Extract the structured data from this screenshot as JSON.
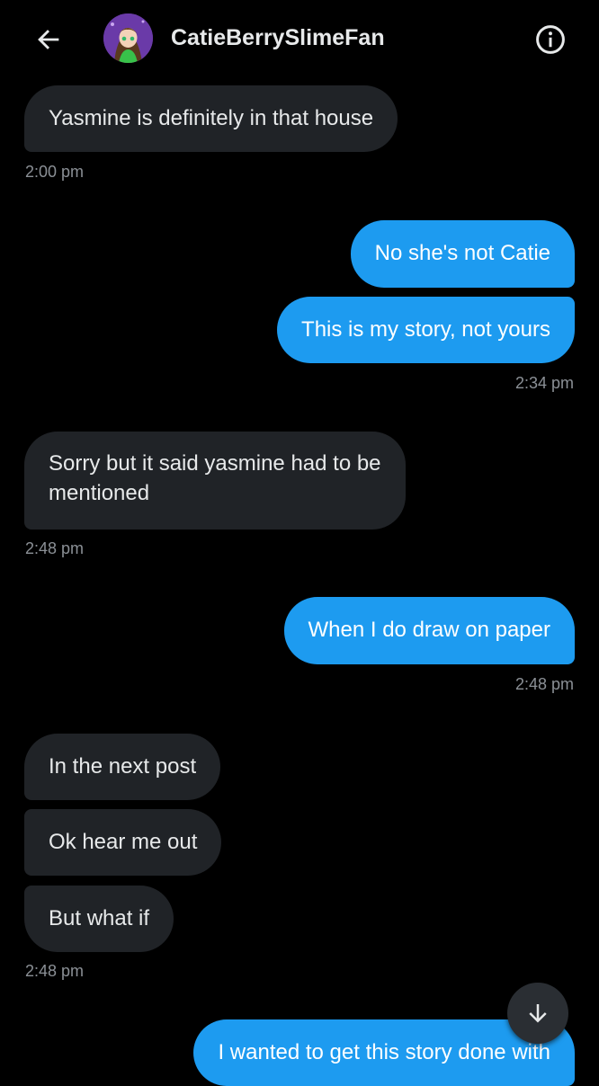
{
  "header": {
    "back_icon": "arrow-left-icon",
    "username": "CatieBerrySlimeFan",
    "info_icon": "info-circle-icon"
  },
  "messages": [
    {
      "direction": "in",
      "text": "Yasmine is definitely in that house"
    },
    {
      "direction": "out",
      "text": "No she's not Catie"
    },
    {
      "direction": "out",
      "text": "This is my story, not yours"
    },
    {
      "direction": "in",
      "text_line1": "Sorry but it said yasmine had to be",
      "text_line2": "mentioned"
    },
    {
      "direction": "out",
      "text": "When I do draw on paper"
    },
    {
      "direction": "in",
      "text": "In the next post"
    },
    {
      "direction": "in",
      "text": "Ok hear me out"
    },
    {
      "direction": "in",
      "text": "But what if"
    },
    {
      "direction": "out",
      "text": "I wanted to get this story done with"
    }
  ],
  "timestamps": [
    "2:00 pm",
    "2:34 pm",
    "2:48 pm",
    "2:48 pm",
    "2:48 pm"
  ],
  "scroll_button_icon": "arrow-down-icon",
  "colors": {
    "background": "#000000",
    "incoming_bubble": "#202327",
    "outgoing_bubble": "#1d9bf0",
    "timestamp": "#8b9096",
    "text": "#e7e9ea"
  }
}
